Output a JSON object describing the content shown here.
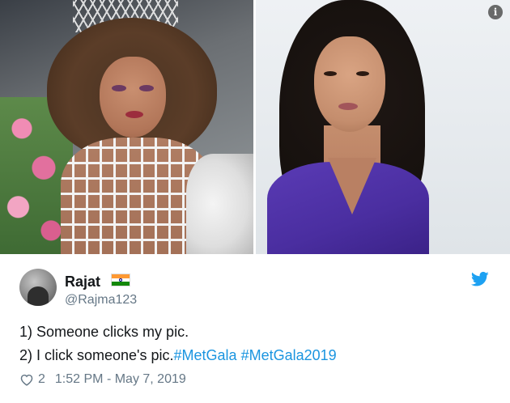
{
  "tweet": {
    "display_name": "Rajat",
    "handle": "@Rajma123",
    "text_line1": "1) Someone clicks my pic.",
    "text_line2_prefix": "2) I click someone's pic.",
    "hashtags": [
      "#MetGala",
      "#MetGala2019"
    ],
    "like_count": "2",
    "timestamp": "1:52 PM - May 7, 2019"
  },
  "media": {
    "info_glyph": "i"
  },
  "icons": {
    "flag": "india-flag-icon",
    "brand": "twitter-bird-icon",
    "like": "heart-icon",
    "info": "info-icon"
  },
  "colors": {
    "hashtag": "#1b95e0",
    "twitter_blue": "#1da1f2",
    "secondary_text": "#657786"
  }
}
